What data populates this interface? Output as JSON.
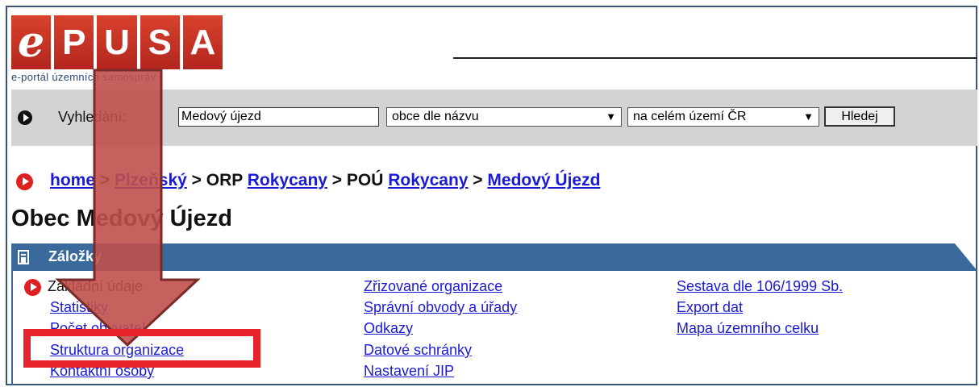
{
  "logo": {
    "letters": [
      "e",
      "P",
      "U",
      "S",
      "A"
    ],
    "tagline": "e-portál územních samospráv"
  },
  "search": {
    "label": "Vyhledání:",
    "value": "Medový újezd",
    "type_select": "obce dle názvu",
    "scope_select": "na celém území ČR",
    "button": "Hledej"
  },
  "breadcrumb": {
    "home": "home",
    "region": "Plzeňský",
    "sep": " > ",
    "orp_prefix": "ORP ",
    "orp": "Rokycany",
    "pou_prefix": "POÚ ",
    "pou": "Rokycany",
    "obec": "Medový Újezd"
  },
  "page_title": "Obec Medový Újezd",
  "tabs": {
    "header": "Záložky",
    "current": "Základní údaje",
    "col1": [
      "Statistiky",
      "Počet obyvatel",
      "Struktura organizace",
      "Kontaktní osoby"
    ],
    "col2": [
      "Zřizované organizace",
      "Správní obvody a úřady",
      "Odkazy",
      "Datové schránky",
      "Nastavení JIP"
    ],
    "col3": [
      "Sestava dle 106/1999 Sb.",
      "Export dat",
      "Mapa územního celku"
    ]
  },
  "colors": {
    "logo_red": "#c0392b",
    "tab_blue": "#3a6a9c",
    "link_blue": "#1a1ad6",
    "highlight_red": "#e8222a",
    "arrow_red": "#c0504d"
  }
}
